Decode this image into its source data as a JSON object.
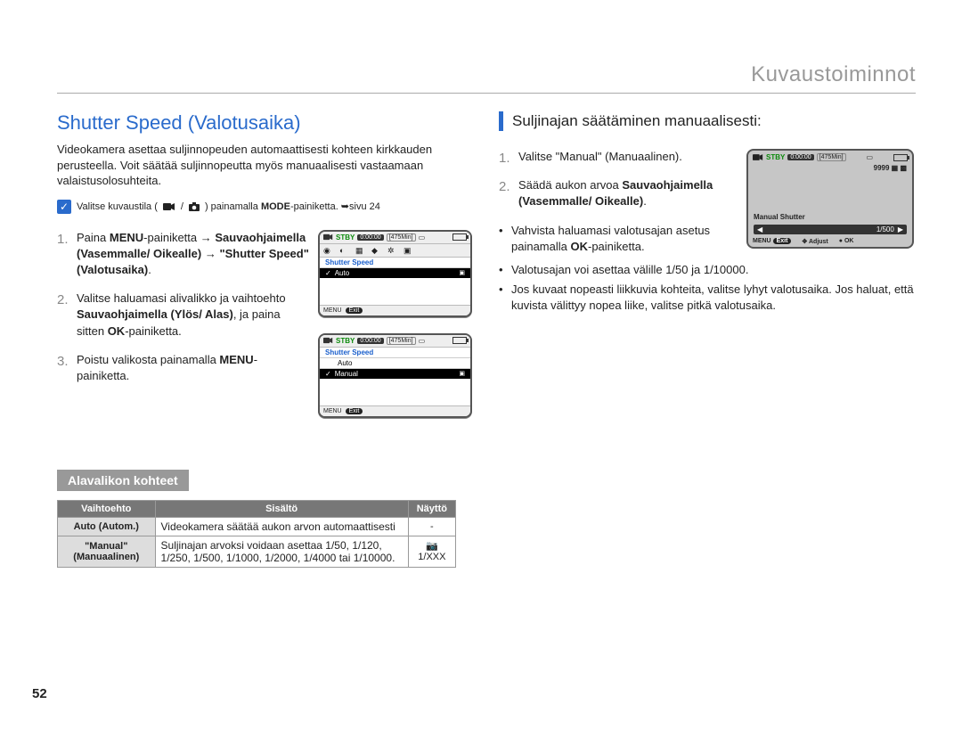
{
  "header": "Kuvaustoiminnot",
  "page_num": "52",
  "left": {
    "title": "Shutter Speed (Valotusaika)",
    "intro": "Videokamera asettaa suljinnopeuden automaattisesti kohteen kirkkauden perusteella. Voit säätää suljinnopeutta myös manuaalisesti vastaamaan valaistusolosuhteita.",
    "mode_before": "Valitse kuvaustila (",
    "mode_after": ") painamalla ",
    "mode_bold": "MODE",
    "mode_tail": "-painiketta. ➥sivu 24",
    "steps": [
      {
        "pre": "Paina ",
        "b1": "MENU",
        "mid1": "-painiketta → ",
        "b2": "Sauvaohjaimella (Vasemmalle/ Oikealle)",
        "mid2": " → ",
        "b3": "\"Shutter Speed\" (Valotusaika)",
        "post": "."
      },
      {
        "pre": "Valitse haluamasi alivalikko ja vaihtoehto ",
        "b1": "Sauvaohjaimella (Ylös/ Alas)",
        "mid1": ", ja paina sitten ",
        "b2": "OK",
        "post": "-painiketta."
      },
      {
        "pre": "Poistu valikosta painamalla ",
        "b1": "MENU",
        "post": "-painiketta."
      }
    ],
    "screen1": {
      "stby": "STBY",
      "time": "0:00:00",
      "min": "[475Min]",
      "menu_title": "Shutter Speed",
      "item": "Auto",
      "menu": "MENU",
      "exit": "Exit"
    },
    "screen2": {
      "stby": "STBY",
      "time": "0:00:00",
      "min": "[475Min]",
      "menu_title": "Shutter Speed",
      "item1": "Auto",
      "item2": "Manual",
      "menu": "MENU",
      "exit": "Exit"
    }
  },
  "sub_section": {
    "heading": "Alavalikon kohteet",
    "headers": [
      "Vaihtoehto",
      "Sisältö",
      "Näyttö"
    ],
    "rows": [
      {
        "opt": "Auto (Autom.)",
        "desc": "Videokamera säätää aukon arvon automaattisesti",
        "disp": "-"
      },
      {
        "opt": "\"Manual\" (Manuaalinen)",
        "desc": "Suljinajan arvoksi voidaan asettaa 1/50, 1/120, 1/250, 1/500, 1/1000, 1/2000, 1/4000 tai 1/10000.",
        "disp": "📷 1/XXX"
      }
    ]
  },
  "right": {
    "title": "Suljinajan säätäminen manuaalisesti:",
    "steps": [
      {
        "text": "Valitse \"Manual\" (Manuaalinen)."
      },
      {
        "pre": "Säädä aukon arvoa ",
        "b1": "Sauvaohjaimella (Vasemmalle/ Oikealle)",
        "post": "."
      }
    ],
    "bullets": [
      {
        "pre": "Vahvista haluamasi valotusajan asetus painamalla ",
        "b1": "OK",
        "post": "-painiketta."
      },
      {
        "text": "Valotusajan voi asettaa välille 1/50 ja 1/10000."
      },
      {
        "text": "Jos kuvaat nopeasti liikkuvia kohteita, valitse lyhyt valotusaika. Jos haluat, että kuvista välittyy nopea liike, valitse pitkä valotusaika."
      }
    ],
    "screen": {
      "stby": "STBY",
      "time": "0:00:00",
      "min": "[475Min]",
      "count": "9999",
      "label": "Manual Shutter",
      "val": "1/500",
      "menu": "MENU",
      "exit": "Exit",
      "adjust": "Adjust",
      "ok": "OK"
    }
  }
}
